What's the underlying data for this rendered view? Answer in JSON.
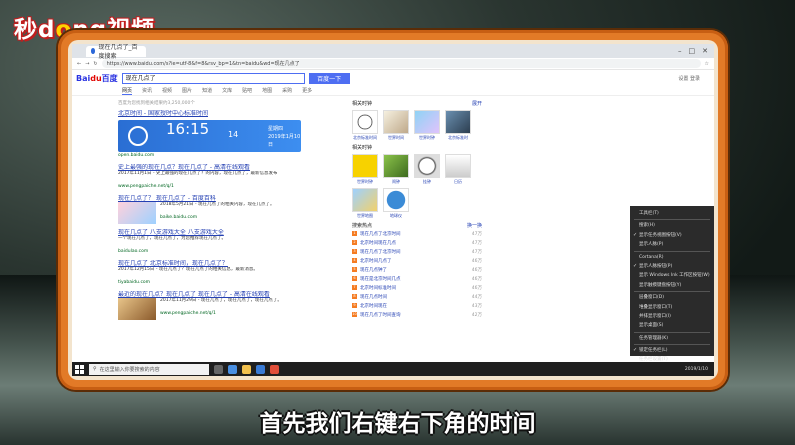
{
  "watermark": {
    "pre": "秒d",
    "o": "o",
    "post": "ng视频"
  },
  "browser": {
    "tab_title": "现在几点了_百度搜索",
    "url": "https://www.baidu.com/s?ie=utf-8&f=8&rsv_bp=1&tn=baidu&wd=现在几点了",
    "search_query": "现在几点了",
    "search_button": "百度一下",
    "top_right": "设置 登录"
  },
  "baidu_logo": {
    "a": "Bai",
    "b": "du",
    "c": "百度"
  },
  "nav_tabs": [
    "网页",
    "资讯",
    "视频",
    "图片",
    "知道",
    "文库",
    "贴吧",
    "地图",
    "采购",
    "更多"
  ],
  "results_meta": "百度为您找到相关结果约3,250,000个",
  "results": {
    "r0": {
      "title": "北京时间 - 国家授时中心标准时间"
    },
    "clock": {
      "time": "16:15",
      "seconds": "14",
      "weekday": "星期四",
      "date": "2019年1月10日"
    },
    "r0_url": "open.baidu.com",
    "r1": {
      "title": "史上最强的现在几点？现在几点了 - 高清在线观看",
      "desc": "2017年11月1日 - 史上最强的现在几点了？的内容，现在几点了，最新信息发布",
      "url": "www.pengpaiche.net/q/1"
    },
    "r2": {
      "title": "现在几点了？ 现在几点了 - 百度百科",
      "desc": "2018年5月21日 - 现在几点了的相关内容，现在几点了。",
      "url": "baike.baidu.com"
    },
    "r3": {
      "title": "现在几点了 八支游戏大全 八支游戏大全",
      "desc": "一个现在几点了，现在几点了，为您推荐现在几点了。",
      "url": "baidulao.com"
    },
    "r4": {
      "title": "现在几点了 北京标准时间，现在几点了？",
      "desc": "2017年12月15日 - 现在几点了？现在几点了的相关信息，最新消息。",
      "url": "tiyabaidu.com"
    },
    "r5": {
      "title": "最近的现在几点？现在几点了 现在几点了 - 高清在线观看",
      "desc": "2017年11月29日 - 现在几点了，现在几点了，现在几点了。",
      "url": "www.pengpaiche.net/q/1"
    }
  },
  "right_col": {
    "related_people": "相关时钟",
    "related_more": "展开",
    "related_items": [
      "北京标准时间",
      "世界时间",
      "世界时钟",
      "北京标准时"
    ],
    "related_watches": "相关时钟",
    "watch_items": [
      "世界时钟",
      "闹钟",
      "挂钟",
      "日历"
    ],
    "watch_items2": [
      "世界地图",
      "地球仪"
    ],
    "hot_title": "搜索热点",
    "hot_more": "换一换",
    "hot": [
      {
        "n": "1",
        "t": "现在几点了北京时间",
        "v": "47万"
      },
      {
        "n": "2",
        "t": "北京时间现在几点",
        "v": "47万"
      },
      {
        "n": "3",
        "t": "现在几点了北京时间",
        "v": "47万"
      },
      {
        "n": "4",
        "t": "北京时间几点了",
        "v": "46万"
      },
      {
        "n": "5",
        "t": "现在几点钟了",
        "v": "46万"
      },
      {
        "n": "6",
        "t": "现在是北京时间几点",
        "v": "46万"
      },
      {
        "n": "7",
        "t": "北京时间标准时间",
        "v": "46万"
      },
      {
        "n": "8",
        "t": "现在几点时间",
        "v": "44万"
      },
      {
        "n": "9",
        "t": "北京时间现在",
        "v": "43万"
      },
      {
        "n": "10",
        "t": "现在几点了时间查询",
        "v": "42万"
      }
    ]
  },
  "context_menu": [
    {
      "label": "工具栏(T)",
      "check": false,
      "sep_after": true
    },
    {
      "label": "搜索(H)",
      "check": false
    },
    {
      "label": "显示任务视图按钮(V)",
      "check": true
    },
    {
      "label": "显示人脉(P)",
      "check": false,
      "sep_after": true
    },
    {
      "label": "Cortana(R)",
      "check": false
    },
    {
      "label": "显示人脉按钮(P)",
      "check": true
    },
    {
      "label": "显示 Windows Ink 工作区按钮(W)",
      "check": false
    },
    {
      "label": "显示触摸键盘按钮(Y)",
      "check": false,
      "sep_after": true
    },
    {
      "label": "层叠窗口(D)",
      "check": false
    },
    {
      "label": "堆叠显示窗口(T)",
      "check": false
    },
    {
      "label": "并排显示窗口(I)",
      "check": false
    },
    {
      "label": "显示桌面(S)",
      "check": false,
      "sep_after": true
    },
    {
      "label": "任务管理器(K)",
      "check": false,
      "sep_after": true
    },
    {
      "label": "锁定任务栏(L)",
      "check": true
    },
    {
      "label": "任务栏设置(T)",
      "check": false
    }
  ],
  "taskbar": {
    "search_placeholder": "在这里输入你要搜索的内容",
    "clock": "2019/1/10"
  },
  "subtitle": "首先我们右键右下角的时间"
}
